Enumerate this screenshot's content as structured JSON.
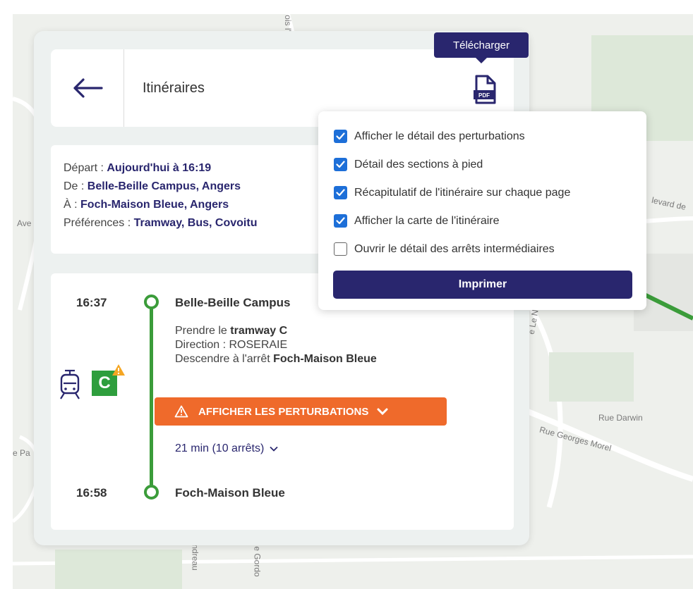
{
  "map": {
    "labels": {
      "boulevard": "levard de",
      "rue_darwin": "Rue Darwin",
      "rue_georges_morel": "Rue Georges Morel",
      "ave": "Ave",
      "pa": "e Pa",
      "rue_le": "e Le N",
      "bottom1": "ndreau",
      "bottom2": "e Gordo",
      "top": "ois l'"
    },
    "route_color": "#3b9c3a"
  },
  "header": {
    "back_icon": "arrow-left-icon",
    "title": "Itinéraires",
    "pdf_icon": "pdf-file-icon",
    "pdf_label": "PDF",
    "tooltip": "Télécharger"
  },
  "info": {
    "depart_label": "Départ : ",
    "depart_value": "Aujourd'hui à 16:19",
    "from_label": "De : ",
    "from_value": "Belle-Beille Campus, Angers",
    "to_label": "À : ",
    "to_value": "Foch-Maison Bleue, Angers",
    "prefs_label": "Préférences : ",
    "prefs_value": "Tramway, Bus, Covoitu"
  },
  "journey": {
    "start_time": "16:37",
    "start_stop": "Belle-Beille Campus",
    "end_time": "16:58",
    "end_stop": "Foch-Maison Bleue",
    "take_prefix": "Prendre le ",
    "take_value": "tramway C",
    "direction": "Direction : ROSERAIE",
    "alight_prefix": "Descendre à l'arrêt ",
    "alight_value": "Foch-Maison Bleue",
    "line_letter": "C",
    "line_color": "#2e9e3d",
    "mode_icon": "tram-icon",
    "perturbations_button": "AFFICHER LES PERTURBATIONS",
    "perturb_color": "#ef6a2b",
    "duration": "21 min (10 arrêts)"
  },
  "print_menu": {
    "options": [
      {
        "label": "Afficher le détail des perturbations",
        "checked": true
      },
      {
        "label": "Détail des sections à pied",
        "checked": true
      },
      {
        "label": "Récapitulatif de l'itinéraire sur chaque page",
        "checked": true
      },
      {
        "label": "Afficher la carte de l'itinéraire",
        "checked": true
      },
      {
        "label": "Ouvrir le détail des arrêts intermédiaires",
        "checked": false
      }
    ],
    "print_button": "Imprimer",
    "accent": "#29266e",
    "checkbox_color": "#1d6fd8"
  }
}
